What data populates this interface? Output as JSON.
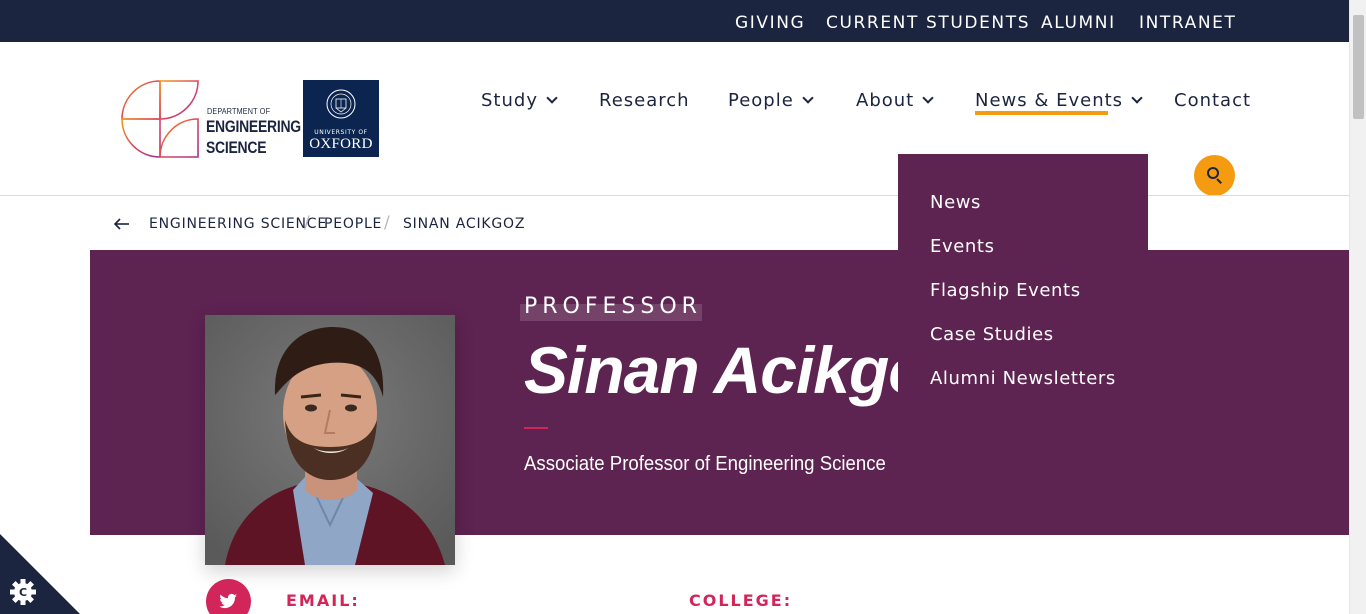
{
  "utility_nav": [
    {
      "label": "GIVING"
    },
    {
      "label": "CURRENT STUDENTS"
    },
    {
      "label": "ALUMNI"
    },
    {
      "label": "INTRANET"
    }
  ],
  "logo": {
    "dept_small": "DEPARTMENT OF",
    "dept_line1": "ENGINEERING",
    "dept_line2": "SCIENCE",
    "oxford_small": "UNIVERSITY OF",
    "oxford_big": "OXFORD"
  },
  "main_nav": [
    {
      "label": "Study",
      "has_dropdown": true
    },
    {
      "label": "Research",
      "has_dropdown": false
    },
    {
      "label": "People",
      "has_dropdown": true
    },
    {
      "label": "About",
      "has_dropdown": true
    },
    {
      "label": "News & Events",
      "has_dropdown": true,
      "active": true
    },
    {
      "label": "Contact",
      "has_dropdown": false
    }
  ],
  "dropdown": [
    {
      "label": "News"
    },
    {
      "label": "Events"
    },
    {
      "label": "Flagship Events"
    },
    {
      "label": "Case Studies"
    },
    {
      "label": "Alumni Newsletters"
    }
  ],
  "breadcrumb": [
    {
      "label": "ENGINEERING SCIENCE"
    },
    {
      "label": "PEOPLE"
    },
    {
      "label": "SINAN ACIKGOZ"
    }
  ],
  "profile": {
    "role": "PROFESSOR",
    "name": "Sinan Acikgoz",
    "subtitle": "Associate Professor of Engineering Science"
  },
  "details": {
    "email_label": "EMAIL:",
    "college_label": "COLLEGE:"
  },
  "icons": {
    "back": "arrow-left-icon",
    "search": "search-icon",
    "twitter": "twitter-icon",
    "cookie": "cookie-settings-icon"
  },
  "colors": {
    "navy": "#1b2540",
    "plum": "#5d2351",
    "orange": "#f49b11",
    "magenta": "#d2265b",
    "oxford_blue": "#0b2550"
  }
}
